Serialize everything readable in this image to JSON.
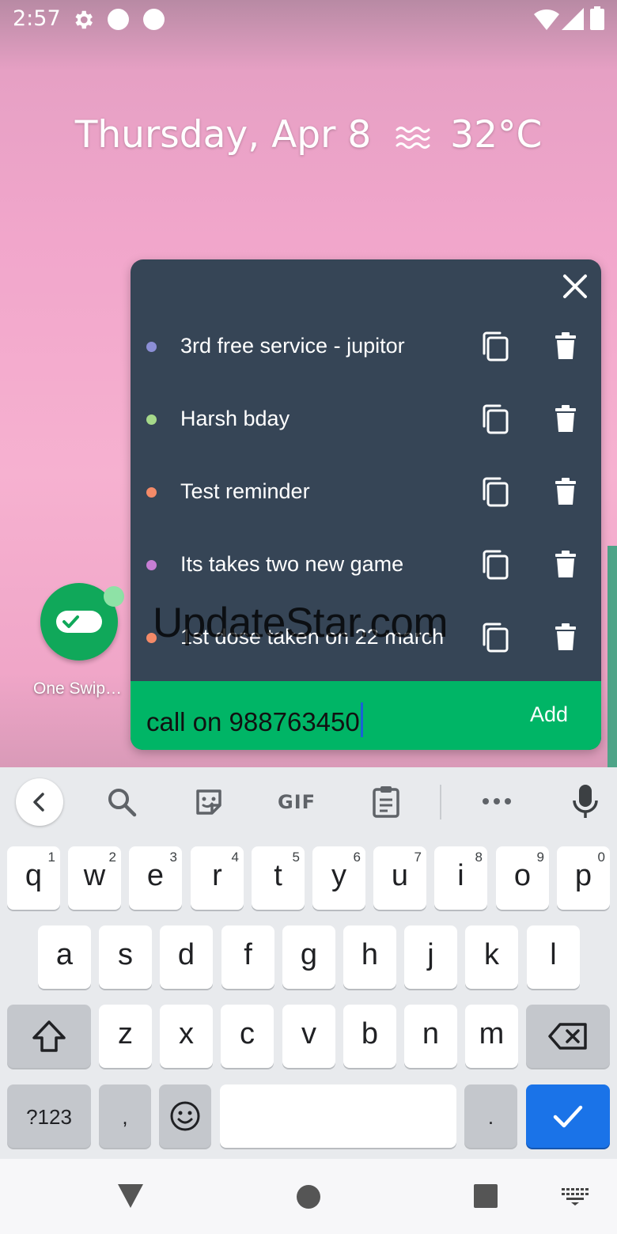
{
  "status_bar": {
    "time": "2:57",
    "icons": [
      "settings-icon",
      "notification-dot-icon",
      "notification-dot-icon",
      "wifi-icon",
      "signal-icon",
      "battery-icon"
    ]
  },
  "home": {
    "date": "Thursday, Apr 8",
    "weather_icon": "haze-icon",
    "temperature": "32°C",
    "app_label": "One Swip…",
    "app_colors": {
      "icon": "#10a85a",
      "badge": "#8ee2a6"
    }
  },
  "panel": {
    "background": "#364556",
    "items": [
      {
        "text": "3rd free service - jupitor",
        "dot_color": "#8c8fd6"
      },
      {
        "text": "Harsh bday",
        "dot_color": "#a6d98a"
      },
      {
        "text": "Test reminder",
        "dot_color": "#f48a68"
      },
      {
        "text": "Its takes two new game",
        "dot_color": "#c77ed4"
      },
      {
        "text": "1st dose taken on 22 march",
        "dot_color": "#f48a68"
      }
    ],
    "input_value": "call on 988763450",
    "add_label": "Add",
    "accent": "#00b566"
  },
  "watermark": "UpdateStar.com",
  "keyboard": {
    "toolbar_gif": "GIF",
    "rows": [
      [
        {
          "l": "q",
          "n": "1"
        },
        {
          "l": "w",
          "n": "2"
        },
        {
          "l": "e",
          "n": "3"
        },
        {
          "l": "r",
          "n": "4"
        },
        {
          "l": "t",
          "n": "5"
        },
        {
          "l": "y",
          "n": "6"
        },
        {
          "l": "u",
          "n": "7"
        },
        {
          "l": "i",
          "n": "8"
        },
        {
          "l": "o",
          "n": "9"
        },
        {
          "l": "p",
          "n": "0"
        }
      ],
      [
        {
          "l": "a"
        },
        {
          "l": "s"
        },
        {
          "l": "d"
        },
        {
          "l": "f"
        },
        {
          "l": "g"
        },
        {
          "l": "h"
        },
        {
          "l": "j"
        },
        {
          "l": "k"
        },
        {
          "l": "l"
        }
      ],
      [
        {
          "l": "z"
        },
        {
          "l": "x"
        },
        {
          "l": "c"
        },
        {
          "l": "v"
        },
        {
          "l": "b"
        },
        {
          "l": "n"
        },
        {
          "l": "m"
        }
      ]
    ],
    "symbols_label": "?123",
    "comma_label": ",",
    "period_label": ".",
    "enter_color": "#1a73e8"
  }
}
